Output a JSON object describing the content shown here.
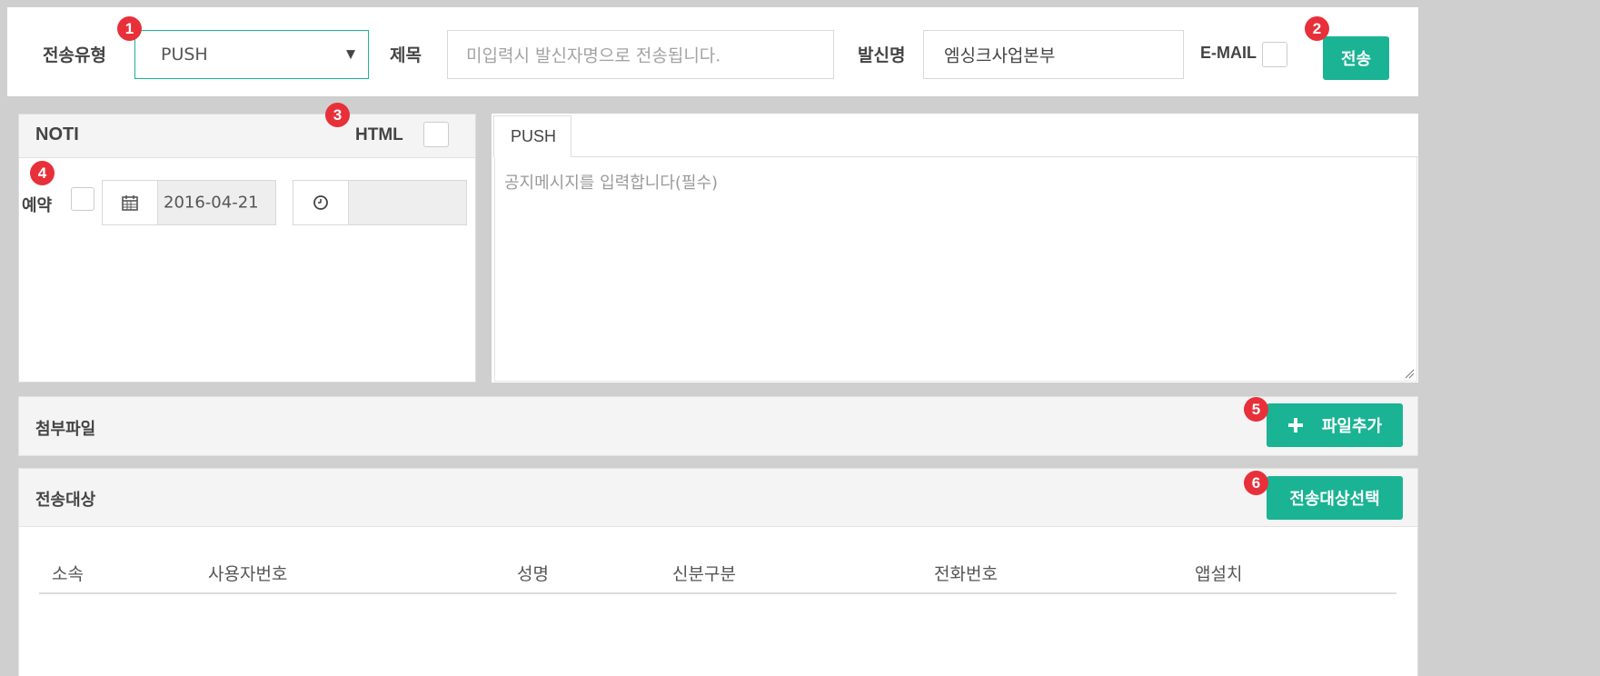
{
  "top_bar": {
    "send_type_label": "전송유형",
    "send_type_value": "PUSH",
    "title_label": "제목",
    "title_placeholder": "미입력시 발신자명으로 전송됩니다.",
    "sender_label": "발신명",
    "sender_value": "엠싱크사업본부",
    "email_label": "E-MAIL",
    "send_button": "전송"
  },
  "noti": {
    "header": "NOTI",
    "html_label": "HTML",
    "reserve_label": "예약",
    "date_value": "2016-04-21",
    "time_value": ""
  },
  "push": {
    "tab_label": "PUSH",
    "message_placeholder": "공지메시지를 입력합니다(필수)"
  },
  "attachment": {
    "title": "첨부파일",
    "add_button": "파일추가"
  },
  "recipients": {
    "title": "전송대상",
    "select_button": "전송대상선택",
    "columns": [
      "소속",
      "사용자번호",
      "성명",
      "신분구분",
      "전화번호",
      "앱설치"
    ]
  },
  "badges": [
    "1",
    "2",
    "3",
    "4",
    "5",
    "6"
  ],
  "colors": {
    "accent": "#1ab394",
    "badge": "#e8303a",
    "panel_header": "#f4f4f4",
    "background": "#cfcfcf"
  },
  "icons": {
    "select_arrow": "▼",
    "calendar": "calendar-icon",
    "clock": "clock-icon",
    "plus": "plus-icon"
  }
}
